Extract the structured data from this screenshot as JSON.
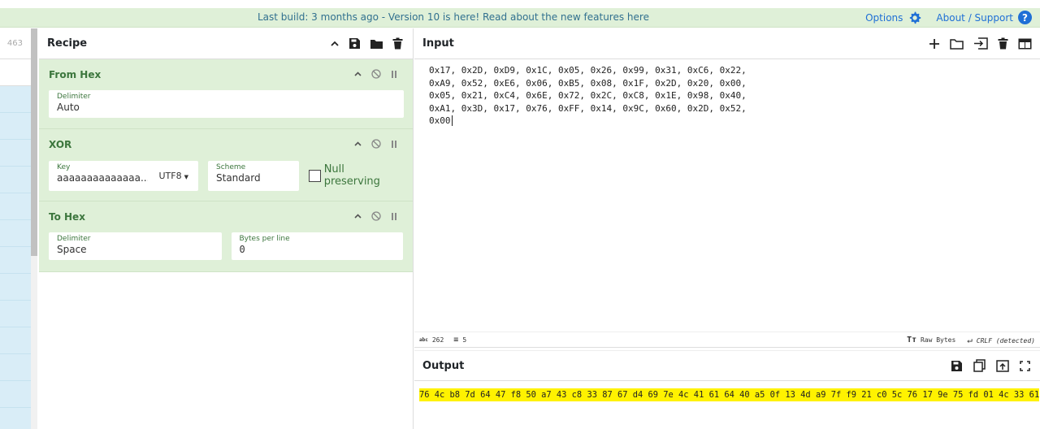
{
  "banner": {
    "message": "Last build: 3 months ago - Version 10 is here! Read about the new features here",
    "options_label": "Options",
    "about_label": "About / Support",
    "help_glyph": "?"
  },
  "operations": {
    "count": "463"
  },
  "recipe": {
    "title": "Recipe",
    "ops": {
      "from_hex": {
        "title": "From Hex",
        "delimiter_label": "Delimiter",
        "delimiter_value": "Auto"
      },
      "xor": {
        "title": "XOR",
        "key_label": "Key",
        "key_value": "aaaaaaaaaaaaaa...",
        "key_encoding": "UTF8",
        "scheme_label": "Scheme",
        "scheme_value": "Standard",
        "null_label": "Null preserving"
      },
      "to_hex": {
        "title": "To Hex",
        "delimiter_label": "Delimiter",
        "delimiter_value": "Space",
        "bpl_label": "Bytes per line",
        "bpl_value": "0"
      }
    }
  },
  "input": {
    "title": "Input",
    "lines": [
      "0x17, 0x2D, 0xD9, 0x1C, 0x05, 0x26, 0x99, 0x31, 0xC6, 0x22,",
      "0xA9, 0x52, 0xE6, 0x06, 0xB5, 0x08, 0x1F, 0x2D, 0x20, 0x00,",
      "0x05, 0x21, 0xC4, 0x6E, 0x72, 0x2C, 0xC8, 0x1E, 0x98, 0x40,",
      "0xA1, 0x3D, 0x17, 0x76, 0xFF, 0x14, 0x9C, 0x60, 0x2D, 0x52,",
      "0x00"
    ],
    "stats": {
      "chars_icon": "abc",
      "chars": "262",
      "lines": "5",
      "raw_bytes_label": "Raw Bytes",
      "eol_label": "CRLF (detected)"
    }
  },
  "output": {
    "title": "Output",
    "text": "76 4c b8 7d 64 47 f8 50 a7 43 c8 33 87 67 d4 69 7e 4c 41 61 64 40 a5 0f 13 4d a9 7f f9 21 c0 5c 76 17 9e 75 fd 01 4c 33 61"
  },
  "colors": {
    "accent": "#1f6fd6",
    "op_bg": "#dff0d8",
    "op_text": "#3c763d",
    "highlight": "#fff200",
    "ops_list_bg": "#d9edf7"
  }
}
